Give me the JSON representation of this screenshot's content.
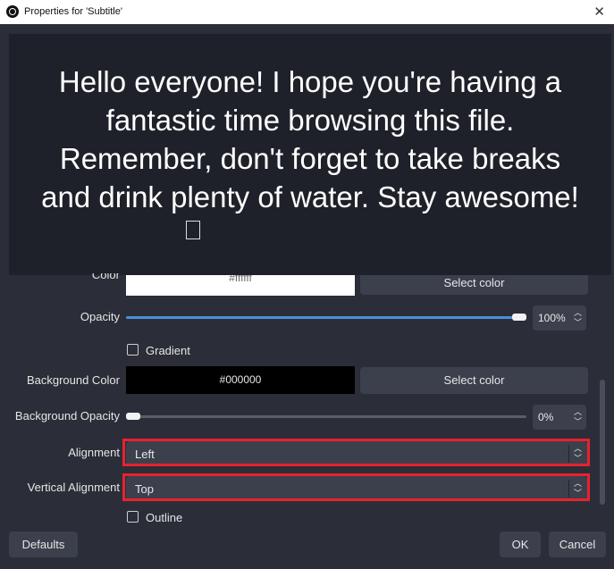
{
  "window": {
    "title": "Properties for 'Subtitle'",
    "close_glyph": "✕"
  },
  "preview": {
    "text": "Hello everyone! I hope you're having a\nfantastic time browsing this file.\nRemember, don't forget to take breaks\nand drink plenty of water. Stay awesome!"
  },
  "color": {
    "label": "Color",
    "hex": "#ffffff",
    "swatch": "#ffffff",
    "button": "Select color"
  },
  "opacity": {
    "label": "Opacity",
    "value_text": "100%",
    "level": 1.0,
    "accent": "#4a90d9"
  },
  "gradient": {
    "label": "Gradient",
    "checked": false
  },
  "background_color": {
    "label": "Background Color",
    "hex": "#000000",
    "swatch": "#000000",
    "button": "Select color"
  },
  "background_opacity": {
    "label": "Background Opacity",
    "value_text": "0%",
    "level": 0.0
  },
  "alignment": {
    "label": "Alignment",
    "value": "Left"
  },
  "vertical_alignment": {
    "label": "Vertical Alignment",
    "value": "Top"
  },
  "outline": {
    "label": "Outline",
    "checked": false
  },
  "footer": {
    "defaults": "Defaults",
    "ok": "OK",
    "cancel": "Cancel"
  },
  "highlight_color": "#e8222e"
}
